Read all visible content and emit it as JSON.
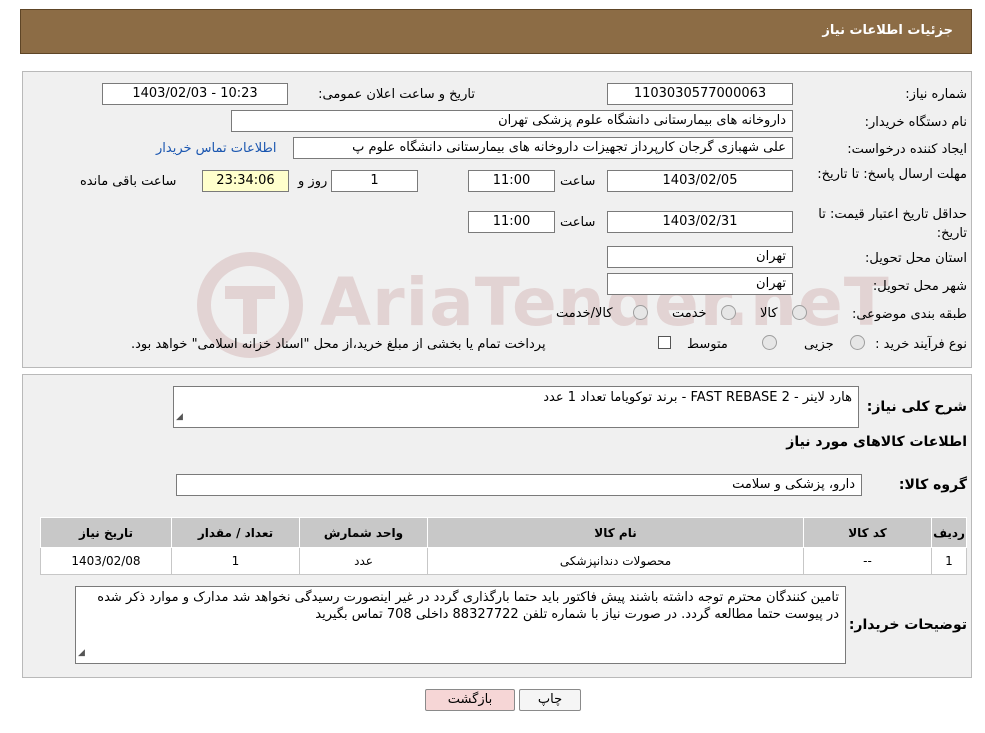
{
  "header": {
    "title": "جزئیات اطلاعات نیاز"
  },
  "fields": {
    "need_number_label": "شماره نیاز:",
    "need_number": "1103030577000063",
    "announce_label": "تاریخ و ساعت اعلان عمومی:",
    "announce_value": "1403/02/03 - 10:23",
    "buyer_org_label": "نام دستگاه خریدار:",
    "buyer_org": "داروخانه های بیمارستانی دانشگاه علوم پزشکی تهران",
    "creator_label": "ایجاد کننده درخواست:",
    "creator": "علی شهبازی گرجان کارپرداز تجهیزات داروخانه های بیمارستانی دانشگاه علوم پ",
    "contact_link": "اطلاعات تماس خریدار",
    "reply_deadline_label": "مهلت ارسال پاسخ: تا تاریخ:",
    "reply_date": "1403/02/05",
    "time_word": "ساعت",
    "reply_time": "11:00",
    "days": "1",
    "days_word": "روز و",
    "remaining": "23:34:06",
    "remaining_word": "ساعت باقی مانده",
    "price_valid_label": "حداقل تاریخ اعتبار قیمت: تا تاریخ:",
    "price_valid_date": "1403/02/31",
    "price_valid_time": "11:00",
    "province_label": "استان محل تحویل:",
    "province": "تهران",
    "city_label": "شهر محل تحویل:",
    "city": "تهران",
    "category_label": "طبقه بندی موضوعی:",
    "category_options": [
      "کالا",
      "خدمت",
      "کالا/خدمت"
    ],
    "process_label": "نوع فرآیند خرید :",
    "process_options": [
      "جزیی",
      "متوسط"
    ],
    "process_note": "پرداخت تمام یا بخشی از مبلغ خرید،از محل \"اسناد خزانه اسلامی\" خواهد بود."
  },
  "summary": {
    "label": "شرح کلی نیاز:",
    "value": "هارد لاینر - FAST REBASE 2 - برند توکویاما تعداد 1 عدد"
  },
  "goods_section_title": "اطلاعات کالاهای مورد نیاز",
  "goods_group": {
    "label": "گروه کالا:",
    "value": "دارو، پزشکی و سلامت"
  },
  "table": {
    "headers": [
      "ردیف",
      "کد کالا",
      "نام کالا",
      "واحد شمارش",
      "تعداد / مقدار",
      "تاریخ نیاز"
    ],
    "rows": [
      [
        "1",
        "--",
        "محصولات دندانپزشکی",
        "عدد",
        "1",
        "1403/02/08"
      ]
    ]
  },
  "buyer_notes": {
    "label": "توضیحات خریدار:",
    "value": "تامین کنندگان محترم توجه داشته باشند پیش فاکتور باید حتما بارگذاری گردد در غیر اینصورت رسیدگی نخواهد شد مدارک و موارد ذکر شده در پیوست حتما مطالعه گردد. در صورت نیاز با شماره تلفن 88327722 داخلی 708 تماس بگیرید"
  },
  "buttons": {
    "print": "چاپ",
    "back": "بازگشت"
  },
  "watermark": "AriaTender.neT",
  "colors": {
    "header_bg": "#8c6c45",
    "panel_bg": "#f0f0f0",
    "back_button_bg": "#f6d6d6",
    "link": "#1a56b0"
  }
}
